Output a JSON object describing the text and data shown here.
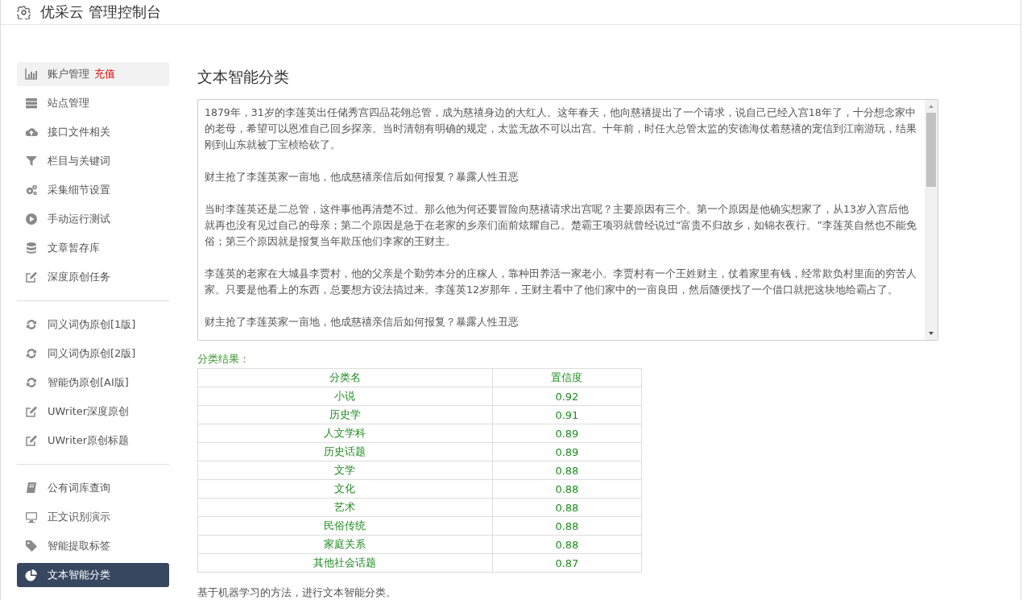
{
  "header": {
    "title": "优采云 管理控制台"
  },
  "sidebar": {
    "groups": [
      {
        "items": [
          {
            "label": "账户管理",
            "badge": "充值",
            "kind": "chart",
            "selected": false,
            "hover": true
          },
          {
            "label": "站点管理",
            "kind": "server",
            "selected": false,
            "hover": false
          },
          {
            "label": "接口文件相关",
            "kind": "cloud",
            "selected": false,
            "hover": false
          },
          {
            "label": "栏目与关键词",
            "kind": "filter",
            "selected": false,
            "hover": false
          },
          {
            "label": "采集细节设置",
            "kind": "gears",
            "selected": false,
            "hover": false
          },
          {
            "label": "手动运行测试",
            "kind": "play",
            "selected": false,
            "hover": false
          },
          {
            "label": "文章暂存库",
            "kind": "database",
            "selected": false,
            "hover": false
          },
          {
            "label": "深度原创任务",
            "kind": "edit",
            "selected": false,
            "hover": false
          }
        ]
      },
      {
        "items": [
          {
            "label": "同义词伪原创[1版]",
            "kind": "refresh",
            "selected": false,
            "hover": false
          },
          {
            "label": "同义词伪原创[2版]",
            "kind": "refresh",
            "selected": false,
            "hover": false
          },
          {
            "label": "智能伪原创[AI版]",
            "kind": "refresh",
            "selected": false,
            "hover": false
          },
          {
            "label": "UWriter深度原创",
            "kind": "edit",
            "selected": false,
            "hover": false
          },
          {
            "label": "UWriter原创标题",
            "kind": "edit",
            "selected": false,
            "hover": false
          }
        ]
      },
      {
        "items": [
          {
            "label": "公有词库查询",
            "kind": "book",
            "selected": false,
            "hover": false
          },
          {
            "label": "正文识别演示",
            "kind": "monitor",
            "selected": false,
            "hover": false
          },
          {
            "label": "智能提取标签",
            "kind": "tag",
            "selected": false,
            "hover": false
          },
          {
            "label": "文本智能分类",
            "kind": "pie",
            "selected": true,
            "hover": false
          }
        ]
      }
    ]
  },
  "main": {
    "title": "文本智能分类",
    "text_area": {
      "value": [
        "1879年，31岁的李莲英出任储秀宫四品花翎总管，成为慈禧身边的大红人。这年春天，他向慈禧提出了一个请求，说自己已经入宫18年了，十分想念家中的老母，希望可以恩准自己回乡探亲。当时清朝有明确的规定，太监无故不可以出宫。十年前，时任大总管太监的安德海仗着慈禧的宠信到江南游玩，结果刚到山东就被丁宝桢给砍了。",
        "财主抢了李莲英家一亩地，他成慈禧亲信后如何报复？暴露人性丑恶",
        "当时李莲英还是二总管，这件事他再清楚不过。那么他为何还要冒险向慈禧请求出宫呢？主要原因有三个。第一个原因是他确实想家了，从13岁入宫后他就再也没有见过自己的母亲；第二个原因是急于在老家的乡亲们面前炫耀自己。楚霸王项羽就曾经说过“富贵不归故乡，如锦衣夜行。”李莲英自然也不能免俗；第三个原因就是报复当年欺压他们李家的王财主。",
        "李莲英的老家在大城县李贾村，他的父亲是个勤劳本分的庄稼人，靠种田养活一家老小。李贾村有一个王姓财主，仗着家里有钱，经常欺负村里面的穷苦人家。只要是他看上的东西，总要想方设法搞过来。李莲英12岁那年，王财主看中了他们家中的一亩良田，然后随便找了一个借口就把这块地给霸占了。",
        "财主抢了李莲英家一亩地，他成慈禧亲信后如何报复？暴露人性丑恶"
      ]
    },
    "result_label": "分类结果：",
    "table": {
      "columns": [
        "分类名",
        "置信度"
      ],
      "rows": [
        [
          "小说",
          "0.92"
        ],
        [
          "历史学",
          "0.91"
        ],
        [
          "人文学科",
          "0.89"
        ],
        [
          "历史话题",
          "0.89"
        ],
        [
          "文学",
          "0.88"
        ],
        [
          "文化",
          "0.88"
        ],
        [
          "艺术",
          "0.88"
        ],
        [
          "民俗传统",
          "0.88"
        ],
        [
          "家庭关系",
          "0.88"
        ],
        [
          "其他社会话题",
          "0.87"
        ]
      ]
    },
    "footnote": "基于机器学习的方法，进行文本智能分类。"
  }
}
